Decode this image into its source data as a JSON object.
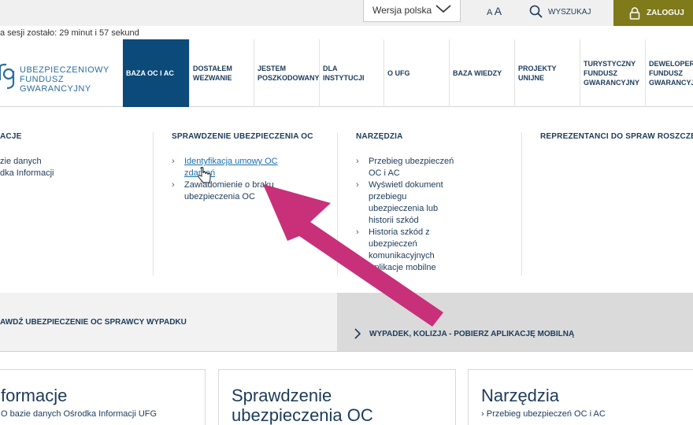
{
  "topbar": {
    "language_selected": "Wersja polska",
    "font_size_small": "A",
    "font_size_large": "A",
    "search_label": "WYSZUKAJ",
    "login_label": "ZALOGUJ"
  },
  "session": {
    "text": "a sesji zostało: 29 minut i 57 sekund"
  },
  "logo": {
    "line1": "UBEZPIECZENIOWY",
    "line2": "FUNDUSZ",
    "line3": "GWARANCYJNY",
    "color": "#2a6ea0"
  },
  "nav": {
    "items": [
      {
        "label": "BAZA OC I AC"
      },
      {
        "label": "DOSTAŁEM WEZWANIE"
      },
      {
        "label": "JESTEM POSZKODOWANY"
      },
      {
        "label": "DLA INSTYTUCJI"
      },
      {
        "label": "O UFG"
      },
      {
        "label": "BAZA WIEDZY"
      },
      {
        "label": "PROJEKTY UNIJNE"
      },
      {
        "label": "TURYSTYCZNY FUNDUSZ GWARANCYJNY"
      },
      {
        "label": "DEWELOPER FUNDUSZ GWARANCYJNY"
      }
    ]
  },
  "mega": {
    "col1": {
      "title": "ACJE",
      "items": [
        "zie danych",
        "dka Informacji"
      ]
    },
    "col2": {
      "title": "SPRAWDZENIE UBEZPIECZENIA OC",
      "items": [
        "Identyfikacja umowy OC zdarzeń",
        "Zawiadomienie o braku ubezpieczenia OC"
      ]
    },
    "col3": {
      "title": "NARZĘDZIA",
      "items": [
        "Przebieg ubezpieczeń OC i AC",
        "Wyświetl dokument przebiegu ubezpieczenia lub historii szkód",
        "Historia szkód z ubezpieczeń komunikacyjnych",
        "Aplikacje mobilne"
      ]
    },
    "col4": {
      "title": "REPREZENTANCI DO SPRAW ROSZCZEŃ"
    }
  },
  "banner": {
    "left": "AWDŹ UBEZPIECZENIE OC SPRAWCY WYPADKU",
    "right": "WYPADEK, KOLIZJA - POBIERZ APLIKACJĘ MOBILNĄ"
  },
  "cards": {
    "card1": {
      "title": "formacje",
      "sub": "O bazie danych Ośrodka Informacji UFG"
    },
    "card2": {
      "title_line1": "Sprawdzenie",
      "title_line2": "ubezpieczenia OC"
    },
    "card3": {
      "title": "Narzędzia",
      "sub": "Przebieg ubezpieczeń OC i AC"
    }
  },
  "colors": {
    "nav_active": "#0c4a7a",
    "login_bg": "#7f7a1a",
    "annotation_arrow": "#c8307a",
    "link": "#1a6fb0"
  }
}
